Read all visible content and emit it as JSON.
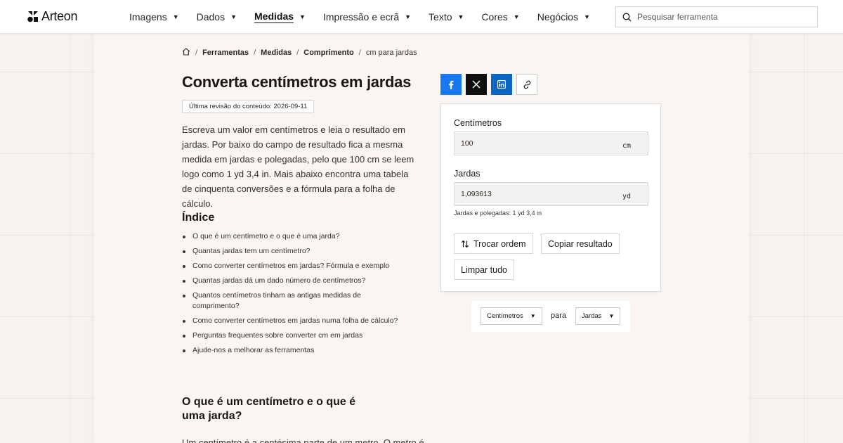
{
  "brand": {
    "name": "Arteon"
  },
  "nav": {
    "items": [
      {
        "label": "Imagens",
        "active": false
      },
      {
        "label": "Dados",
        "active": false
      },
      {
        "label": "Medidas",
        "active": true
      },
      {
        "label": "Impressão e ecrã",
        "active": false
      },
      {
        "label": "Texto",
        "active": false
      },
      {
        "label": "Cores",
        "active": false
      },
      {
        "label": "Negócios",
        "active": false
      }
    ]
  },
  "search": {
    "placeholder": "Pesquisar ferramenta"
  },
  "breadcrumb": {
    "items": [
      "Ferramentas",
      "Medidas",
      "Comprimento"
    ],
    "current": "cm para jardas"
  },
  "page": {
    "title": "Converta centímetros em jardas",
    "revision": "Última revisão do conteúdo: 2026-09-11",
    "intro": "Escreva um valor em centímetros e leia o resultado em jardas. Por baixo do campo de resultado fica a mesma medida em jardas e polegadas, pelo que 100 cm se leem logo como 1 yd 3,4 in. Mais abaixo encontra uma tabela de cinquenta conversões e a fórmula para a folha de cálculo."
  },
  "toc": {
    "title": "Índice",
    "items": [
      "O que é um centímetro e o que é uma jarda?",
      "Quantas jardas tem um centímetro?",
      "Como converter centímetros em jardas? Fórmula e exemplo",
      "Quantas jardas dá um dado número de centímetros?",
      "Quantos centímetros tinham as antigas medidas de comprimento?",
      "Como converter centímetros em jardas numa folha de cálculo?",
      "Perguntas frequentes sobre converter cm em jardas",
      "Ajude-nos a melhorar as ferramentas"
    ]
  },
  "section": {
    "title": "O que é um centímetro e o que é uma jarda?",
    "body": "Um centímetro é a centésima parte de um metro. O metro é"
  },
  "share": {
    "icons": [
      "facebook-icon",
      "x-icon",
      "linkedin-icon",
      "link-icon"
    ]
  },
  "converter": {
    "from_label": "Centímetros",
    "from_value": "100",
    "from_unit": "cm",
    "to_label": "Jardas",
    "to_value": "1,093613",
    "to_unit": "yd",
    "hint": "Jardas e polegadas: 1 yd 3,4 in",
    "swap_label": "Trocar ordem",
    "copy_label": "Copiar resultado",
    "clear_label": "Limpar tudo"
  },
  "selector": {
    "from": "Centímetros",
    "connector": "para",
    "to": "Jardas"
  },
  "colors": {
    "facebook": "#1877f2",
    "x": "#0f0f0f",
    "linkedin": "#0a66c2",
    "background": "#f6f2ee"
  }
}
